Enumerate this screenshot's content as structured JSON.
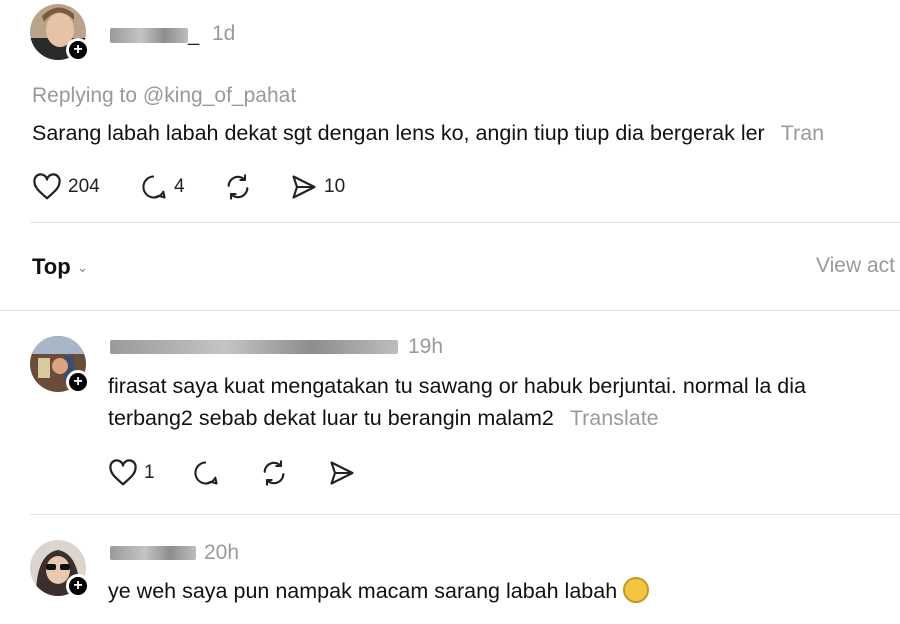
{
  "main_post": {
    "username_visible": "_",
    "time": "1d",
    "reply_to": "Replying to @king_of_pahat",
    "text": "Sarang labah labah dekat sgt dengan lens ko, angin tiup tiup dia bergerak ler",
    "translate_label": "Tran",
    "likes": "204",
    "comments": "4",
    "shares": "10"
  },
  "sort": {
    "label": "Top",
    "view_activity": "View act"
  },
  "comments": [
    {
      "time": "19h",
      "line1": "firasat saya kuat mengatakan tu sawang or habuk berjuntai. normal la dia",
      "line2": "terbang2 sebab dekat luar tu berangin malam2",
      "translate_label": "Translate",
      "likes": "1"
    },
    {
      "time": "20h",
      "text": "ye weh saya pun nampak macam sarang labah labah"
    }
  ],
  "colors": {
    "muted": "#999999",
    "divider": "#e3e3e3"
  }
}
